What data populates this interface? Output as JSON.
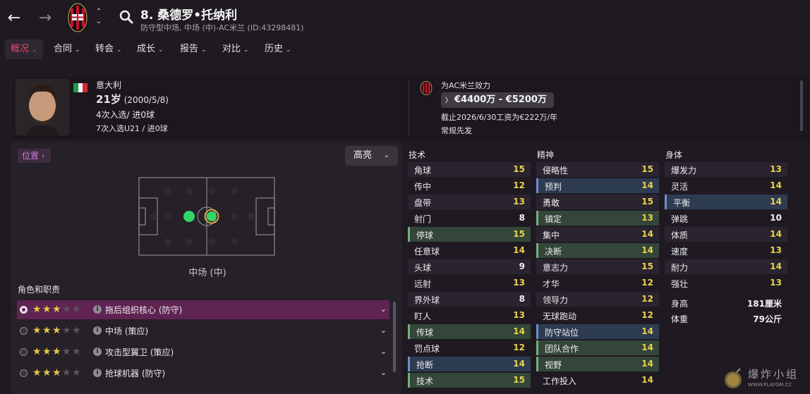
{
  "topbar": {
    "back_icon": "arrow-left-icon",
    "forward_icon": "arrow-right-icon",
    "search_icon": "search-icon",
    "title": "8. 桑德罗•托纳利",
    "subtitle": "防守型中场, 中场 (中)-AC米兰 (ID:43298481)"
  },
  "tabs": [
    {
      "label": "概况",
      "active": true
    },
    {
      "label": "合同"
    },
    {
      "label": "转会"
    },
    {
      "label": "成长"
    },
    {
      "label": "报告"
    },
    {
      "label": "对比"
    },
    {
      "label": "历史"
    }
  ],
  "profile": {
    "nationality": "意大利",
    "age": "21岁",
    "birth": "(2000/5/8)",
    "caps": "4次入选/ 进0球",
    "u21_caps": "7次入选U21 / 进0球",
    "club_label": "为AC米兰效力",
    "value": "€4400万 - €5200万",
    "contract": "截止2026/6/30工资为€222万/年",
    "status": "常规先发"
  },
  "position_panel": {
    "link_label": "位置",
    "highlight_label": "高亮",
    "pitch_label": "中场 (中)",
    "roles_heading": "角色和职责",
    "roles": [
      {
        "label": "拖后组织核心 (防守)",
        "stars": 3,
        "active": true
      },
      {
        "label": "中场 (策应)",
        "stars": 3
      },
      {
        "label": "攻击型翼卫 (策应)",
        "stars": 3
      },
      {
        "label": "抢球机器 (防守)",
        "stars": 3
      }
    ]
  },
  "attributes": {
    "technical": {
      "heading": "技术",
      "rows": [
        {
          "name": "角球",
          "value": "15"
        },
        {
          "name": "传中",
          "value": "12"
        },
        {
          "name": "盘带",
          "value": "13"
        },
        {
          "name": "射门",
          "value": "8"
        },
        {
          "name": "停球",
          "value": "15",
          "hl": "green"
        },
        {
          "name": "任意球",
          "value": "14"
        },
        {
          "name": "头球",
          "value": "9"
        },
        {
          "name": "远射",
          "value": "13"
        },
        {
          "name": "界外球",
          "value": "8"
        },
        {
          "name": "盯人",
          "value": "13"
        },
        {
          "name": "传球",
          "value": "14",
          "hl": "green"
        },
        {
          "name": "罚点球",
          "value": "12"
        },
        {
          "name": "抢断",
          "value": "14",
          "hl": "blue"
        },
        {
          "name": "技术",
          "value": "15",
          "hl": "green"
        }
      ]
    },
    "mental": {
      "heading": "精神",
      "rows": [
        {
          "name": "侵略性",
          "value": "15"
        },
        {
          "name": "预判",
          "value": "14",
          "hl": "blue"
        },
        {
          "name": "勇敢",
          "value": "15"
        },
        {
          "name": "镇定",
          "value": "13",
          "hl": "green"
        },
        {
          "name": "集中",
          "value": "14"
        },
        {
          "name": "决断",
          "value": "14",
          "hl": "green"
        },
        {
          "name": "意志力",
          "value": "15"
        },
        {
          "name": "才华",
          "value": "12"
        },
        {
          "name": "领导力",
          "value": "12"
        },
        {
          "name": "无球跑动",
          "value": "12"
        },
        {
          "name": "防守站位",
          "value": "14",
          "hl": "blue"
        },
        {
          "name": "团队合作",
          "value": "14",
          "hl": "green"
        },
        {
          "name": "视野",
          "value": "14",
          "hl": "green"
        },
        {
          "name": "工作投入",
          "value": "14"
        }
      ]
    },
    "physical": {
      "heading": "身体",
      "rows": [
        {
          "name": "爆发力",
          "value": "13"
        },
        {
          "name": "灵活",
          "value": "14"
        },
        {
          "name": "平衡",
          "value": "14",
          "hl": "blue"
        },
        {
          "name": "弹跳",
          "value": "10"
        },
        {
          "name": "体质",
          "value": "14"
        },
        {
          "name": "速度",
          "value": "13"
        },
        {
          "name": "耐力",
          "value": "14"
        },
        {
          "name": "强壮",
          "value": "13"
        }
      ],
      "height_label": "身高",
      "height_value": "181厘米",
      "weight_label": "体重",
      "weight_value": "79公斤"
    }
  },
  "watermark": {
    "text": "爆炸小组",
    "url": "WWW.PLAYGM.CC"
  },
  "colors": {
    "accent": "#e04b6a",
    "value_yellow": "#e9d24a",
    "role_active": "#5f2451",
    "green_highlight": "#34463a",
    "blue_highlight": "#2e3c52"
  }
}
